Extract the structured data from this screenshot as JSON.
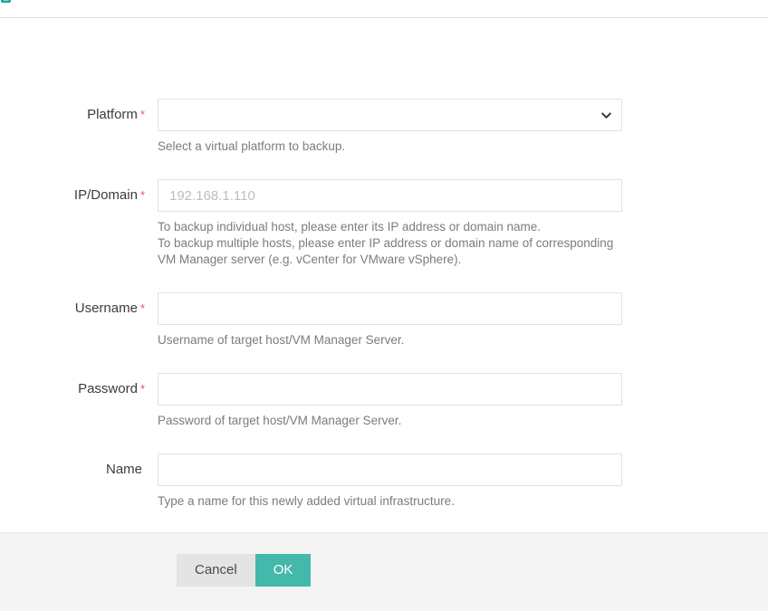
{
  "header": {
    "logo_icon": "app-logo-icon",
    "logo_color": "#19a8a0"
  },
  "form": {
    "fields": [
      {
        "label": "Platform",
        "required": true,
        "required_marker": "*",
        "type": "select",
        "value": "",
        "placeholder": "",
        "icon": "chevron-down-icon",
        "help": [
          "Select a virtual platform to backup."
        ]
      },
      {
        "label": "IP/Domain",
        "required": true,
        "required_marker": "*",
        "type": "text",
        "value": "",
        "placeholder": "192.168.1.110",
        "help": [
          "To backup individual host, please enter its IP address or domain name.",
          "To backup multiple hosts, please enter IP address or domain name of corresponding",
          "VM Manager server (e.g. vCenter for VMware vSphere)."
        ]
      },
      {
        "label": "Username",
        "required": true,
        "required_marker": "*",
        "type": "text",
        "value": "",
        "placeholder": "",
        "help": [
          "Username of target host/VM Manager Server."
        ]
      },
      {
        "label": "Password",
        "required": true,
        "required_marker": "*",
        "type": "password",
        "value": "",
        "placeholder": "",
        "help": [
          "Password of target host/VM Manager Server."
        ]
      },
      {
        "label": "Name",
        "required": false,
        "required_marker": "",
        "type": "text",
        "value": "",
        "placeholder": "",
        "help": [
          "Type a name for this newly added virtual infrastructure."
        ]
      }
    ]
  },
  "footer": {
    "cancel_label": "Cancel",
    "ok_label": "OK",
    "ok_color": "#45b8ac",
    "cancel_color": "#e4e4e4",
    "background": "#f4f4f4"
  },
  "colors": {
    "accent": "#45b8ac",
    "required_asterisk": "#e05b5b",
    "help_text": "#7c7c7c",
    "border": "#e1e1e1",
    "placeholder": "#bdbdbd"
  }
}
